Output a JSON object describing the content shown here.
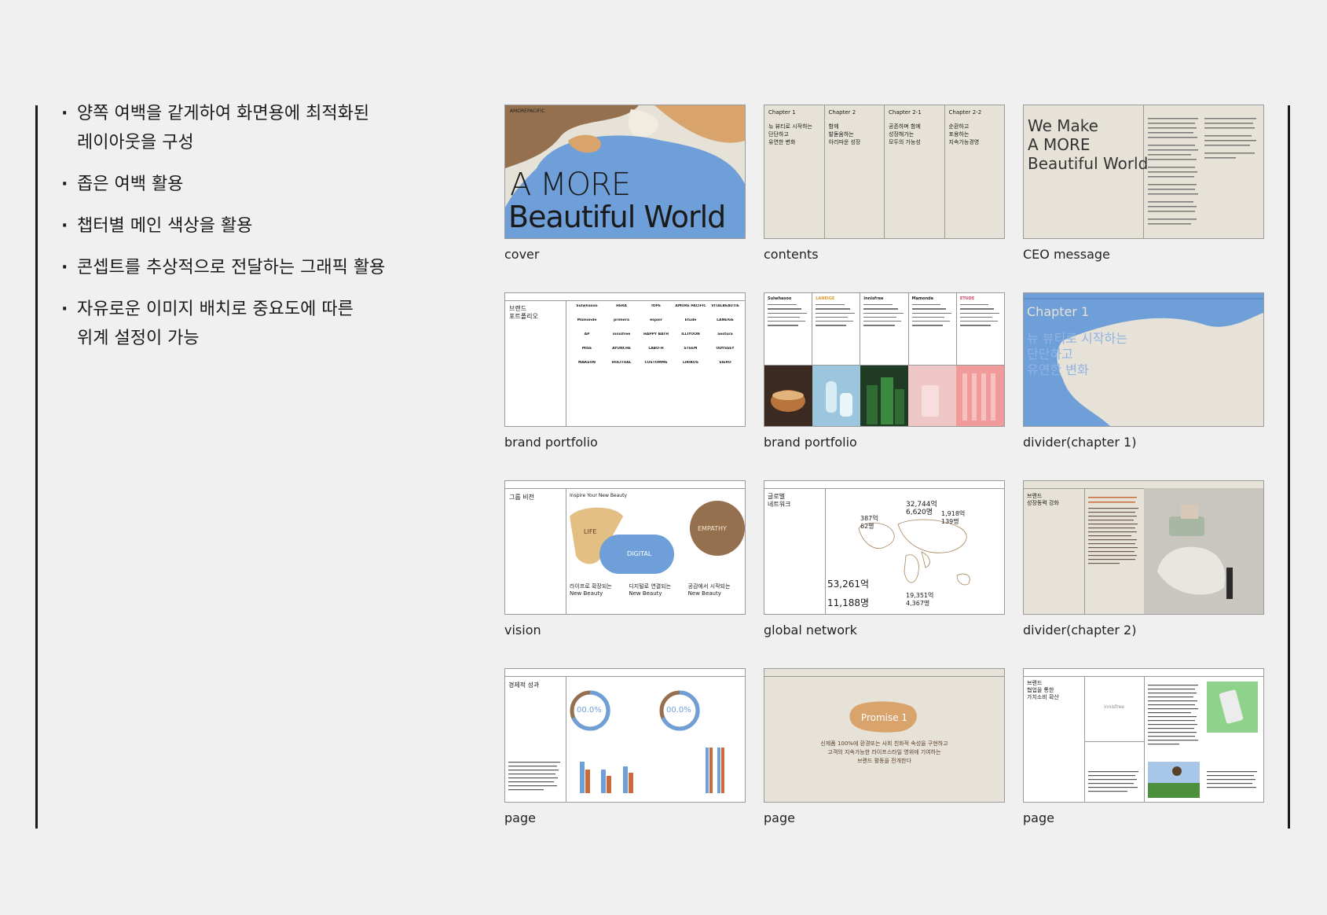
{
  "bullets": [
    {
      "text": "양쪽 여백을 같게하여 화면용에 최적화된\n레이아웃을 구성"
    },
    {
      "text": "좁은 여백 활용"
    },
    {
      "text": "챕터별 메인 색상을 활용"
    },
    {
      "text": "콘셉트를 추상적으로 전달하는 그래픽 활용"
    },
    {
      "text": "자유로운 이미지 배치로 중요도에 따른\n위계 설정이 가능"
    }
  ],
  "colors": {
    "background": "#f0f0f0",
    "beige": "#e7e2d7",
    "blue": "#6f9fd8",
    "brown": "#94704e",
    "tan": "#d9a36c",
    "ink": "#1a1a1a"
  },
  "thumbnails": [
    {
      "caption": "cover",
      "header": "AMOREPACIFIC",
      "title_line1": "A MORE",
      "title_line2": "Beautiful World"
    },
    {
      "caption": "contents",
      "columns": [
        {
          "head": "Chapter 1",
          "body": "뉴 뷰티로 시작하는\n단단하고\n유연한 변화"
        },
        {
          "head": "Chapter 2",
          "body": "함께\n발돋움하는\n아리따운 성장"
        },
        {
          "head": "Chapter 2-1",
          "body": "공존하며 함께\n성장해가는\n모두의 가능성"
        },
        {
          "head": "Chapter 2-2",
          "body": "순환하고\n포용하는\n지속가능경영"
        }
      ]
    },
    {
      "caption": "CEO message",
      "title": "We Make\nA MORE\nBeautiful World"
    },
    {
      "caption": "brand portfolio",
      "title": "브랜드\n포트폴리오",
      "brands": [
        "Sulwhasoo",
        "HERA",
        "IOPE",
        "AMORE PACIFIC",
        "VITALBEAUTIE",
        "Mamonde",
        "primera",
        "espoir",
        "Etude",
        "LANEIGE",
        "AP",
        "innisfree",
        "HAPPY BATH",
        "ILLIYOON",
        "aestura",
        "MISE",
        "AYUNCHE",
        "LABO-H",
        "STEEM",
        "ODYSSEY",
        "MAKEON",
        "HOLITUAL",
        "CUSTOMME",
        "LIRIKOS",
        "SIERO"
      ]
    },
    {
      "caption": "brand portfolio",
      "brands": [
        "Sulwhasoo",
        "LANEIGE",
        "innisfree",
        "Mamonde",
        "ETUDE"
      ]
    },
    {
      "caption": "divider(chapter 1)",
      "chapter": "Chapter 1",
      "title": "뉴 뷰티로 시작하는\n단단하고\n유연한 변화"
    },
    {
      "caption": "vision",
      "title": "그룹 비전",
      "tagline": "Inspire Your New Beauty",
      "shapes": [
        "LIFE",
        "DIGITAL",
        "EMPATHY"
      ],
      "columns": [
        "라이프로 확장되는\nNew Beauty",
        "디지털로 연결되는\nNew Beauty",
        "공감에서 시작되는\nNew Beauty"
      ]
    },
    {
      "caption": "global network",
      "title": "글로벌\n네트워크",
      "stats": [
        "32,744억",
        "6,620명",
        "1,918억",
        "139명",
        "387억",
        "62명",
        "53,261억",
        "11,188명",
        "19,351억",
        "4,367명"
      ]
    },
    {
      "caption": "divider(chapter 2)",
      "title": "브랜드\n성장동력 강화"
    },
    {
      "caption": "page",
      "title": "경제적 성과",
      "donut1": "00.0%",
      "donut2": "00.0%"
    },
    {
      "caption": "page",
      "badge": "Promise 1",
      "text": "신제품 100%에 환경또는 사회 친화적 속성을 구현하고\n고객의 지속가능한 라이프스타일 영위에 기여하는\n브랜드 활동을 전개한다"
    },
    {
      "caption": "page",
      "title": "브랜드\n협업을 통한\n가치소비 확산",
      "logo": "innisfree"
    }
  ]
}
